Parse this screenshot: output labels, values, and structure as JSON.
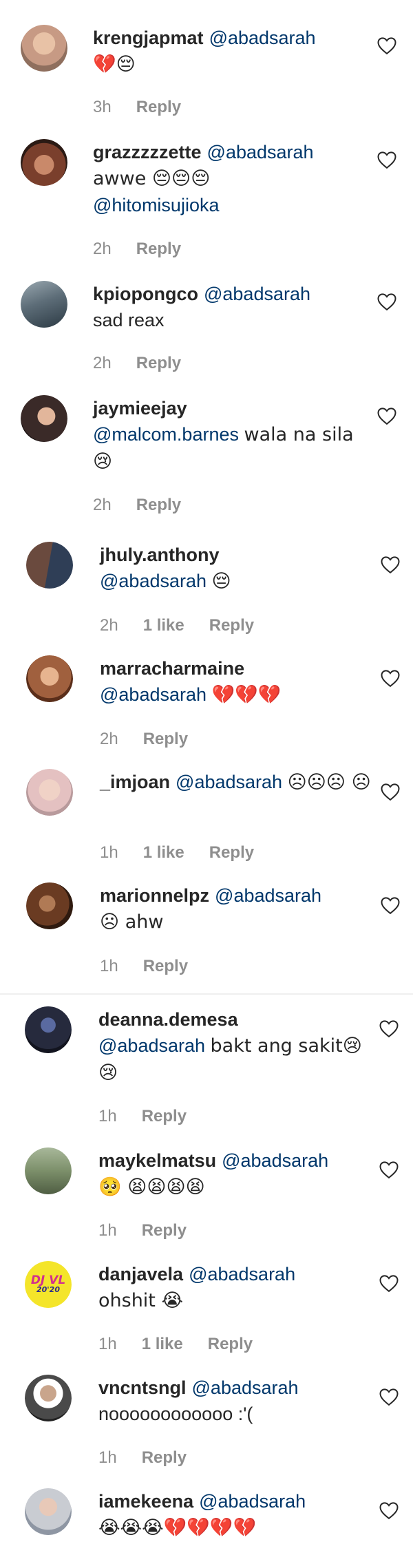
{
  "comments": [
    {
      "username": "krengjapmat",
      "mention": "@abadsarah",
      "text": "💔😔",
      "time": "3h",
      "likes": "",
      "reply": "Reply",
      "avatar_color": "#c79a84"
    },
    {
      "username": "grazzzzzette",
      "mention": "@abadsarah",
      "text": "awwe 😔😔😔",
      "mention2": "@hitomisujioka",
      "time": "2h",
      "likes": "",
      "reply": "Reply",
      "avatar_color": "#7a3f2c"
    },
    {
      "username": "kpiopongco",
      "mention": "@abadsarah",
      "text": "sad reax",
      "time": "2h",
      "likes": "",
      "reply": "Reply",
      "avatar_color": "#5d6d78"
    },
    {
      "username": "jaymieejay",
      "mention": "@malcom.barnes",
      "text": "wala na sila 😢",
      "time": "2h",
      "likes": "",
      "reply": "Reply",
      "avatar_color": "#3a2a28"
    },
    {
      "username": "jhuly.anthony",
      "mention": "@abadsarah",
      "text": "😔",
      "time": "2h",
      "likes": "1 like",
      "reply": "Reply",
      "avatar_color": "#2f3e56"
    },
    {
      "username": "marracharmaine",
      "mention": "@abadsarah",
      "text": "💔💔💔",
      "time": "2h",
      "likes": "",
      "reply": "Reply",
      "avatar_color": "#a0603e"
    },
    {
      "username": "_imjoan",
      "mention": "@abadsarah",
      "text": "☹☹☹ ☹",
      "time": "1h",
      "likes": "1 like",
      "reply": "Reply",
      "avatar_color": "#e4c1c1"
    },
    {
      "username": "marionnelpz",
      "mention": "@abadsarah",
      "text": "☹ ahw",
      "time": "1h",
      "likes": "",
      "reply": "Reply",
      "avatar_color": "#6a3b22"
    },
    {
      "username": "deanna.demesa",
      "mention": "@abadsarah",
      "text": "bakt ang sakit😢😢",
      "time": "1h",
      "likes": "",
      "reply": "Reply",
      "avatar_color": "#262a3d"
    },
    {
      "username": "maykelmatsu",
      "mention": "@abadsarah",
      "text": "🥺 😫😫😫😫",
      "time": "1h",
      "likes": "",
      "reply": "Reply",
      "avatar_color": "#7c8f6a"
    },
    {
      "username": "danjavela",
      "mention": "@abadsarah",
      "text": "ohshit 😭",
      "time": "1h",
      "likes": "1 like",
      "reply": "Reply",
      "avatar_color": "#f4e52a",
      "avatar_text": "DJ VL",
      "avatar_sub": "20'20"
    },
    {
      "username": "vncntsngl",
      "mention": "@abadsarah",
      "text": "noooooooooooo :'(",
      "time": "1h",
      "likes": "",
      "reply": "Reply",
      "avatar_color": "#4a4a4a"
    },
    {
      "username": "iamekeena",
      "mention": "@abadsarah",
      "text": "😭😭😭💔💔💔💔",
      "time": "",
      "likes": "",
      "reply": "",
      "avatar_color": "#c9ccd2"
    }
  ]
}
